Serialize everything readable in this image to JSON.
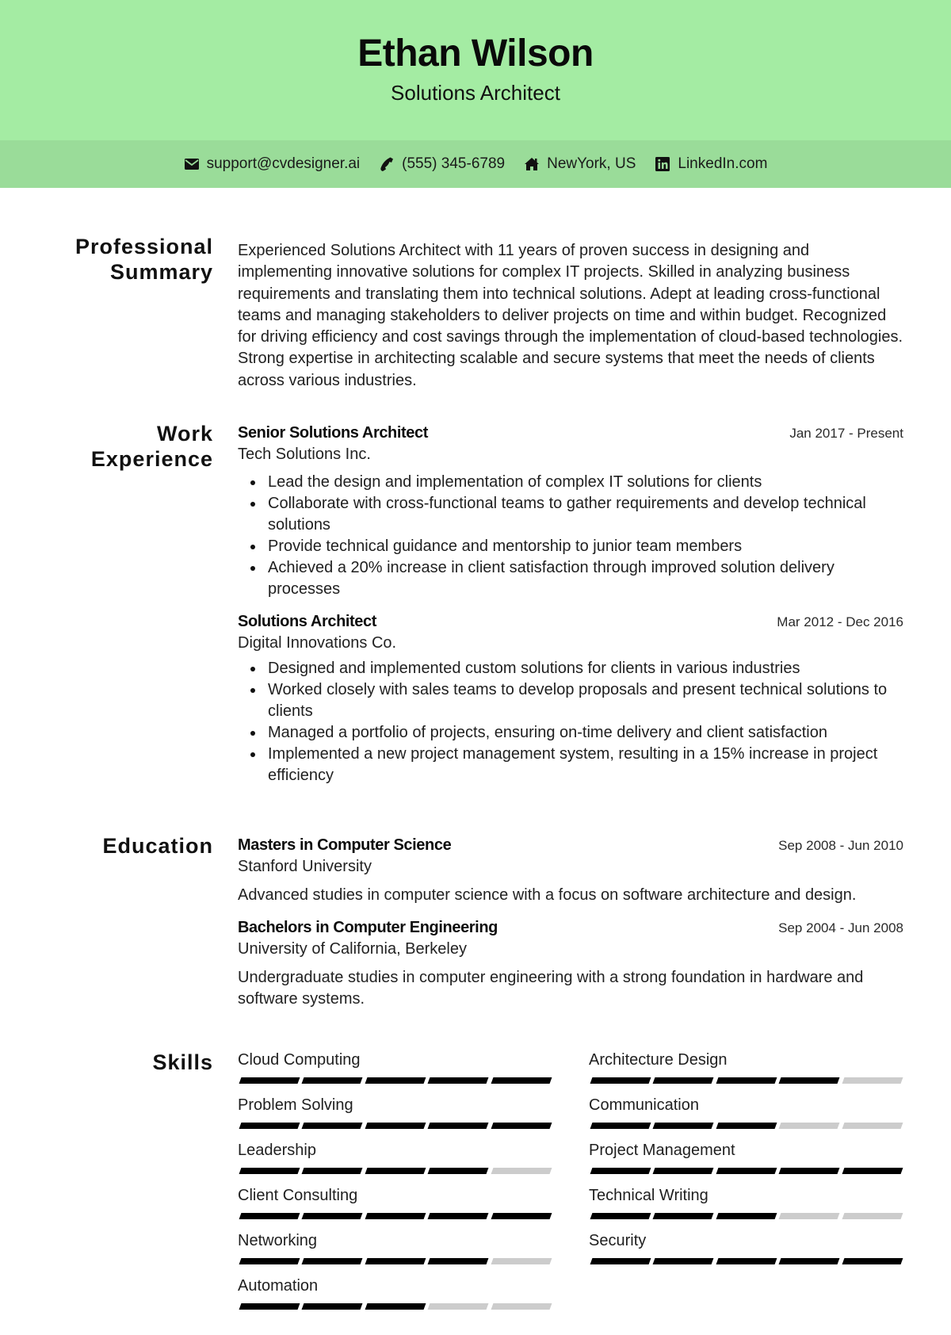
{
  "header": {
    "name": "Ethan Wilson",
    "title": "Solutions Architect"
  },
  "contact": [
    {
      "icon": "envelope-icon",
      "text": "support@cvdesigner.ai"
    },
    {
      "icon": "phone-icon",
      "text": "(555) 345-6789"
    },
    {
      "icon": "home-icon",
      "text": "NewYork, US"
    },
    {
      "icon": "linkedin-icon",
      "text": "LinkedIn.com"
    }
  ],
  "colors": {
    "header_bg": "#a4eca3",
    "contact_bg": "#9adc99",
    "skill_filled": "#000000",
    "skill_empty": "#cccccc"
  },
  "summary": {
    "heading": "Professional Summary",
    "text": "Experienced Solutions Architect with 11 years of proven success in designing and implementing innovative solutions for complex IT projects. Skilled in analyzing business requirements and translating them into technical solutions. Adept at leading cross-functional teams and managing stakeholders to deliver projects on time and within budget. Recognized for driving efficiency and cost savings through the implementation of cloud-based technologies. Strong expertise in architecting scalable and secure systems that meet the needs of clients across various industries."
  },
  "experience": {
    "heading": "Work Experience",
    "jobs": [
      {
        "title": "Senior Solutions Architect",
        "company": "Tech Solutions Inc.",
        "dates": "Jan 2017 - Present",
        "bullets": [
          "Lead the design and implementation of complex IT solutions for clients",
          "Collaborate with cross-functional teams to gather requirements and develop technical solutions",
          "Provide technical guidance and mentorship to junior team members",
          "Achieved a 20% increase in client satisfaction through improved solution delivery processes"
        ]
      },
      {
        "title": "Solutions Architect",
        "company": "Digital Innovations Co.",
        "dates": "Mar 2012 - Dec 2016",
        "bullets": [
          "Designed and implemented custom solutions for clients in various industries",
          "Worked closely with sales teams to develop proposals and present technical solutions to clients",
          "Managed a portfolio of projects, ensuring on-time delivery and client satisfaction",
          "Implemented a new project management system, resulting in a 15% increase in project efficiency"
        ]
      }
    ]
  },
  "education": {
    "heading": "Education",
    "items": [
      {
        "degree": "Masters in Computer Science",
        "school": "Stanford University",
        "dates": "Sep 2008 - Jun 2010",
        "description": "Advanced studies in computer science with a focus on software architecture and design."
      },
      {
        "degree": "Bachelors in Computer Engineering",
        "school": "University of California, Berkeley",
        "dates": "Sep 2004 - Jun 2008",
        "description": "Undergraduate studies in computer engineering with a strong foundation in hardware and software systems."
      }
    ]
  },
  "skills": {
    "heading": "Skills",
    "max_level": 5,
    "items": [
      {
        "name": "Cloud Computing",
        "level": 5
      },
      {
        "name": "Architecture Design",
        "level": 4
      },
      {
        "name": "Problem Solving",
        "level": 5
      },
      {
        "name": "Communication",
        "level": 3
      },
      {
        "name": "Leadership",
        "level": 4
      },
      {
        "name": "Project Management",
        "level": 5
      },
      {
        "name": "Client Consulting",
        "level": 5
      },
      {
        "name": "Technical Writing",
        "level": 3
      },
      {
        "name": "Networking",
        "level": 4
      },
      {
        "name": "Security",
        "level": 5
      },
      {
        "name": "Automation",
        "level": 3
      }
    ]
  }
}
